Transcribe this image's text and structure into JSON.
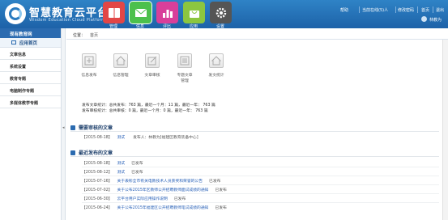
{
  "brand": {
    "title": "智慧教育云平台",
    "subtitle": "Wisdom Education Cloud Platform"
  },
  "nav_tiles": [
    {
      "label": "管理",
      "icon": "book-icon",
      "color": "#e24646"
    },
    {
      "label": "信息",
      "icon": "envelope-icon",
      "color": "#4cc04c"
    },
    {
      "label": "评比",
      "icon": "bar-chart-icon",
      "color": "#d83f9a"
    },
    {
      "label": "应用",
      "icon": "bag-icon",
      "color": "#8cc63f"
    },
    {
      "label": "设置",
      "icon": "gear-icon",
      "color": "#555555"
    }
  ],
  "top_links": {
    "help": "帮助",
    "online": "当前在线(5)人",
    "password": "修改密码",
    "home": "首页",
    "logout": "退出"
  },
  "user": {
    "name": "林教为"
  },
  "sidebar": {
    "header": "现有教育网",
    "current": "应用首页",
    "items": [
      "文章信息",
      "系统设置",
      "教育专题",
      "电脑制作专题",
      "多媒体教学专题"
    ]
  },
  "breadcrumb": {
    "label": "位置：",
    "current": "首页"
  },
  "tiles": [
    {
      "label": "信息发布",
      "icon": "plus-doc-icon"
    },
    {
      "label": "信息管理",
      "icon": "house-icon"
    },
    {
      "label": "文章审核",
      "icon": "edit-icon"
    },
    {
      "label": "专题文章",
      "label2": "管理",
      "icon": "list-doc-icon"
    },
    {
      "label": "发文统计",
      "icon": "house-icon"
    }
  ],
  "stats": {
    "line1": "发布文章统计：总共发布：763 篇，最近一个月：11 篇，最近一年： 763 篇",
    "line2": "发布审核统计：总共审核：0 篇，最近一个月：0 篇，最近一年： 763 篇"
  },
  "pending_section": {
    "title": "需要审核的文章",
    "rows": [
      {
        "date": "【2015-08-18】",
        "title": "测试",
        "meta": "发布人：林教为[福建区教育装备中心]"
      }
    ]
  },
  "recent_section": {
    "title": "最近发布的文章",
    "rows": [
      {
        "date": "【2015-08-18】",
        "title": "测试",
        "state": "已发布"
      },
      {
        "date": "【2015-08-12】",
        "title": "测试",
        "state": "已发布"
      },
      {
        "date": "【2015-07-16】",
        "title": "关于表彰全市有关电教技术人员获奖和荣誉的公告",
        "state": "已发布"
      },
      {
        "date": "【2015-07-02】",
        "title": "关于公布2015年区教师公开招聘教师面试成绩的通知",
        "state": "已发布"
      },
      {
        "date": "【2015-06-30】",
        "title": "云平台用户实际应用操作说明",
        "state": "已发布"
      },
      {
        "date": "【2015-06-24】",
        "title": "关于公布2015年福建区公开招聘教师笔试成绩的通知",
        "state": "已发布"
      }
    ]
  }
}
